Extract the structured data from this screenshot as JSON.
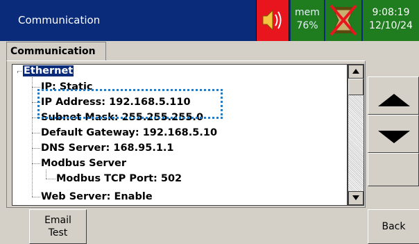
{
  "header": {
    "title": "Communication",
    "alarm_icon": "speaker-icon",
    "memory_label": "mem",
    "memory_value": "76%",
    "network_icon": "network-disconnected-icon",
    "time": "9:08:19",
    "date": "12/10/24"
  },
  "tab": {
    "label": "Communication"
  },
  "tree": {
    "root": "Ethernet",
    "items": [
      "IP: Static",
      "IP Address: 192.168.5.110",
      "Subnet Mask: 255.255.255.0",
      "Default Gateway: 192.168.5.10",
      "DNS Server: 168.95.1.1",
      "Modbus Server",
      "Modbus TCP Port: 502",
      "Web Server: Enable"
    ]
  },
  "side_buttons": {
    "up_icon": "arrow-up-icon",
    "down_icon": "arrow-down-icon"
  },
  "bottom": {
    "email_line1": "Email",
    "email_line2": "Test",
    "back": "Back"
  },
  "colors": {
    "title_bar": "#0a2a7a",
    "status_green": "#1f7d1f",
    "alarm_red": "#e8141e",
    "selection": "#0a2a7a"
  }
}
